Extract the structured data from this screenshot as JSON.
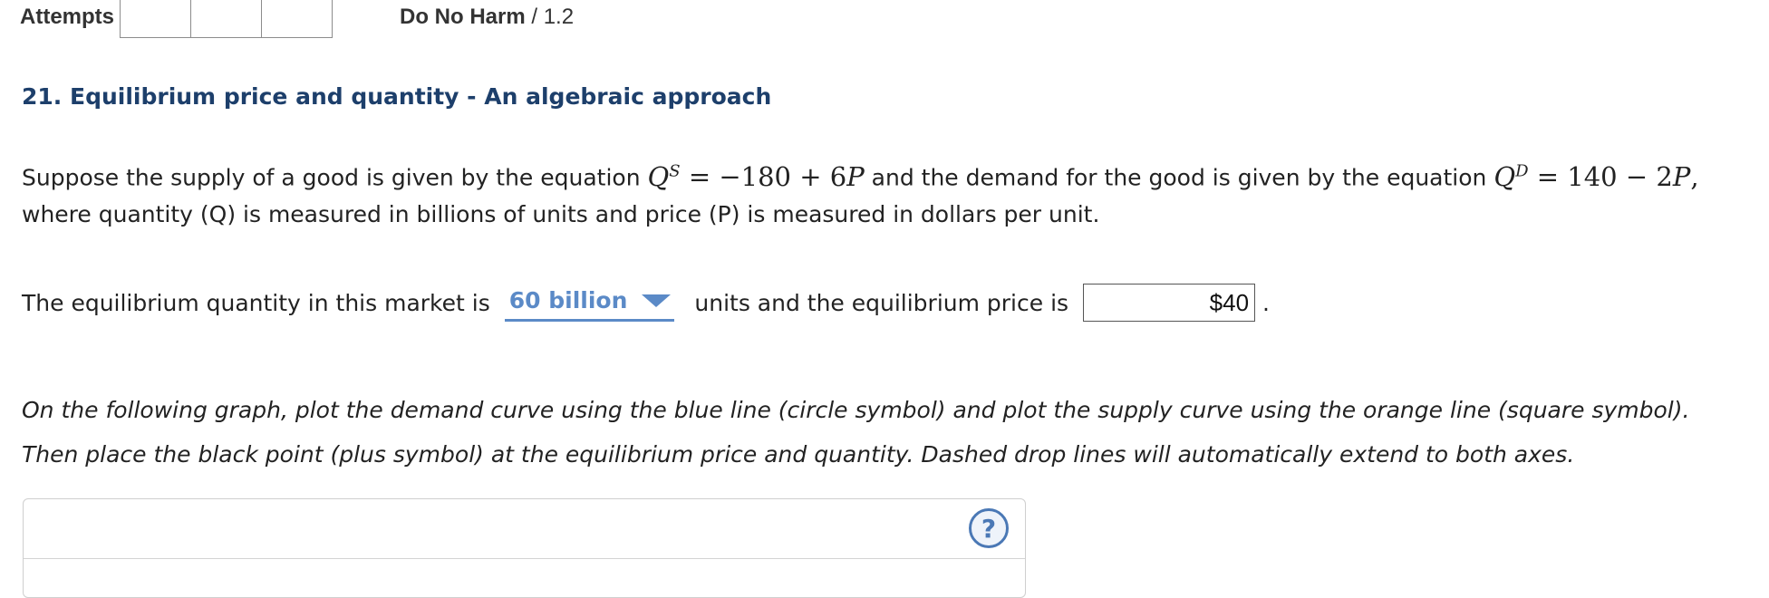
{
  "header": {
    "attempts_label": "Attempts",
    "assignment_name": "Do No Harm",
    "assignment_separator": " / ",
    "assignment_score": "1.2"
  },
  "question": {
    "title": "21. Equilibrium price and quantity - An algebraic approach",
    "intro_before_supply": "Suppose the supply of a good is given by the equation",
    "supply_equation": "Q^S = −180 + 6P",
    "intro_between": "and the demand for the good is given by the equation",
    "demand_equation": "Q^D = 140 − 2P,",
    "intro_line2": "where quantity (Q) is measured in billions of units and price (P) is measured in dollars per unit."
  },
  "answer": {
    "text_before": "The equilibrium quantity in this market is",
    "quantity_selected": "60 billion",
    "text_middle": "units and the equilibrium price is",
    "price_value": "$40",
    "period": "."
  },
  "instructions": {
    "line1": "On the following graph, plot the demand curve using the blue line (circle symbol) and plot the supply curve using the orange line (square symbol).",
    "line2": "Then place the black point (plus symbol) at the equilibrium price and quantity. Dashed drop lines will automatically extend to both axes."
  },
  "graph": {
    "help_label": "?"
  },
  "colors": {
    "title": "#1d3f6b",
    "accent": "#5b8ac7",
    "help": "#4a78b5"
  },
  "icons": {
    "dropdown": "chevron-down-icon",
    "help": "question-mark-icon"
  }
}
